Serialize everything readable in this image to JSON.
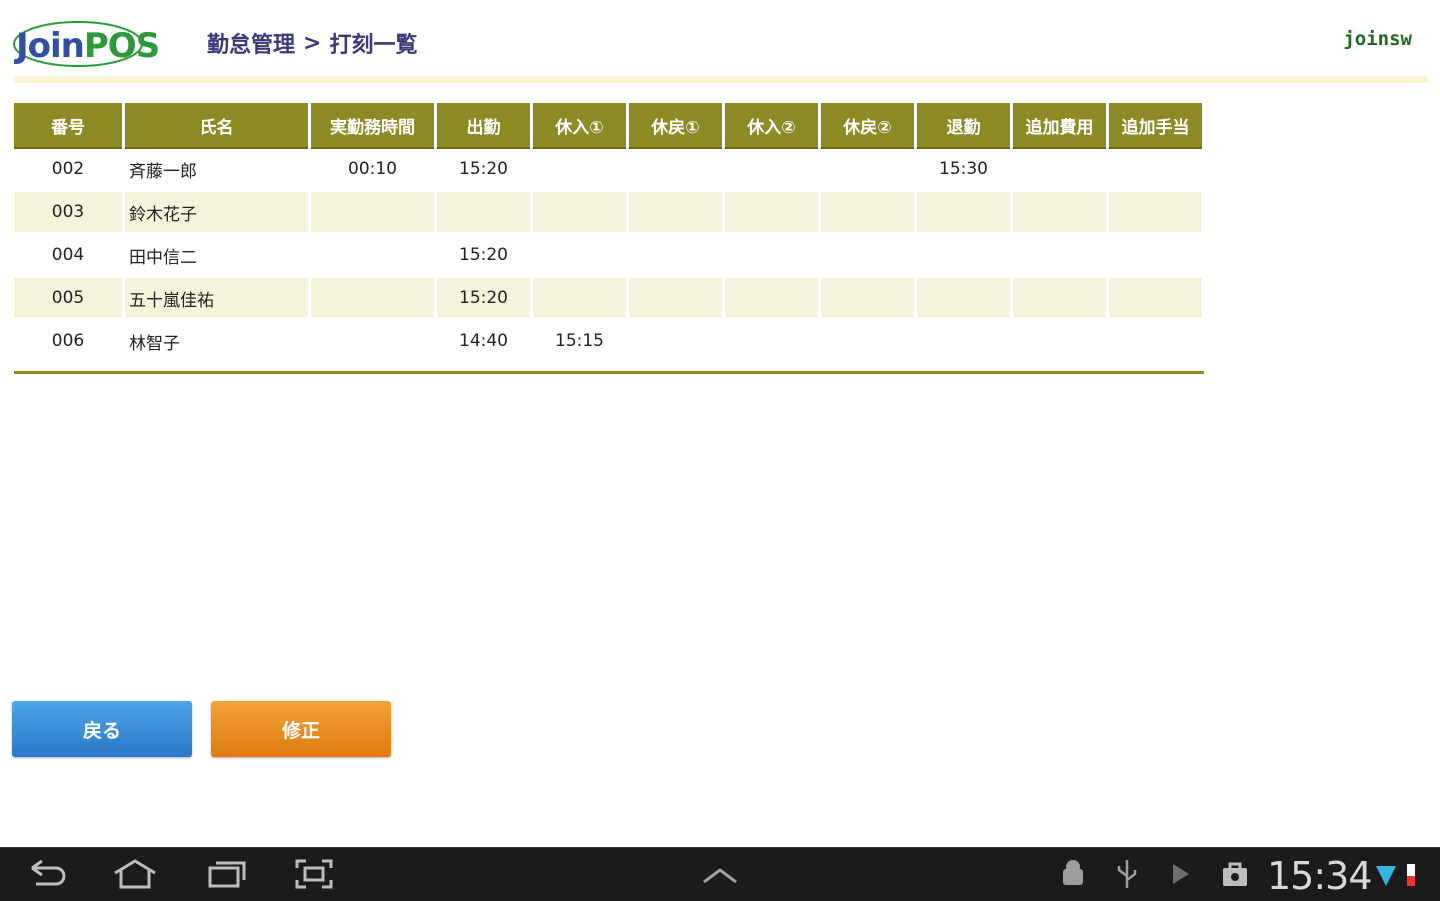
{
  "app": {
    "logo_join": "Join",
    "logo_pos": "POS",
    "breadcrumb_parent": "勤怠管理",
    "breadcrumb_sep": ">",
    "breadcrumb_current": "打刻一覧",
    "user": "joinsw"
  },
  "table": {
    "headers": [
      "番号",
      "氏名",
      "実勤務時間",
      "出勤",
      "休入①",
      "休戻①",
      "休入②",
      "休戻②",
      "退勤",
      "追加費用",
      "追加手当"
    ],
    "rows": [
      [
        "002",
        "斉藤一郎",
        "00:10",
        "15:20",
        "",
        "",
        "",
        "",
        "15:30",
        "",
        ""
      ],
      [
        "003",
        "鈴木花子",
        "",
        "",
        "",
        "",
        "",
        "",
        "",
        "",
        ""
      ],
      [
        "004",
        "田中信二",
        "",
        "15:20",
        "",
        "",
        "",
        "",
        "",
        "",
        ""
      ],
      [
        "005",
        "五十嵐佳祐",
        "",
        "15:20",
        "",
        "",
        "",
        "",
        "",
        "",
        ""
      ],
      [
        "006",
        "林智子",
        "",
        "14:40",
        "15:15",
        "",
        "",
        "",
        "",
        "",
        ""
      ]
    ]
  },
  "buttons": {
    "back": "戻る",
    "edit": "修正"
  },
  "system_bar": {
    "time": "15:34"
  },
  "colors": {
    "header_bg": "#8e8a24",
    "row_alt": "#f5f3d8",
    "back_button": "#2a78c8",
    "edit_button": "#e07a0c"
  }
}
